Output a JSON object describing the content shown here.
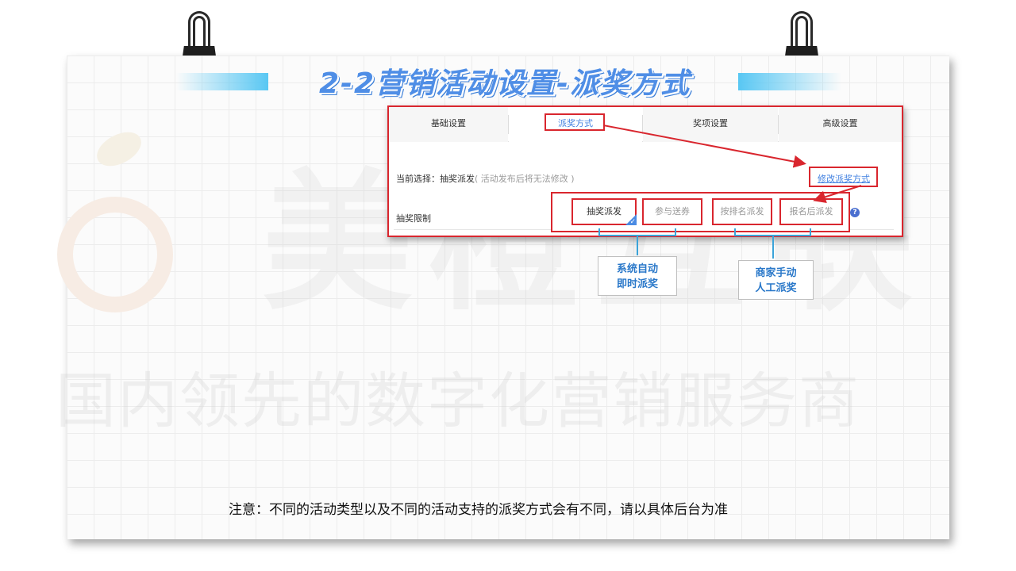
{
  "title": "2-2营销活动设置-派奖方式",
  "watermark": {
    "brand": "美橙互联",
    "slogan": "国内领先的数字化营销服务商"
  },
  "tabs": [
    {
      "label": "基础设置",
      "active": false
    },
    {
      "label": "派奖方式",
      "active": true
    },
    {
      "label": "奖项设置",
      "active": false
    },
    {
      "label": "高级设置",
      "active": false
    }
  ],
  "current_selection": {
    "label": "当前选择：抽奖派发",
    "note": "( 活动发布后将无法修改 )"
  },
  "modify_link": "修改派奖方式",
  "limit_label": "抽奖限制",
  "methods": [
    {
      "label": "抽奖派发",
      "selected": true
    },
    {
      "label": "参与送券",
      "selected": false
    },
    {
      "label": "按排名派发",
      "selected": false
    },
    {
      "label": "报名后派发",
      "selected": false
    }
  ],
  "help_icon": "?",
  "callouts": {
    "auto": {
      "line1": "系统自动",
      "line2": "即时派奖"
    },
    "manual": {
      "line1": "商家手动",
      "line2": "人工派奖"
    }
  },
  "notice": "注意：不同的活动类型以及不同的活动支持的派奖方式会有不同，请以具体后台为准",
  "colors": {
    "highlight_red": "#d9262e",
    "accent_blue": "#3f7fe0",
    "bracket_blue": "#3aa3d9",
    "title_blue": "#4f8ee6"
  }
}
